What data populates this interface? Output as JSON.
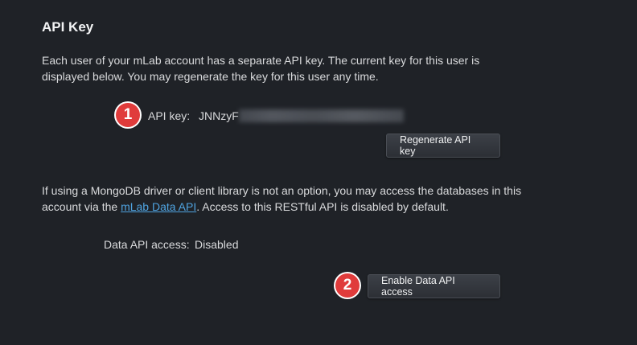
{
  "section": {
    "title": "API Key",
    "description": "Each user of your mLab account has a separate API key. The current key for this user is displayed below. You may regenerate the key for this user any time."
  },
  "api_key": {
    "label": "API key:",
    "value_visible": "JNNzyF",
    "value_obscured": true
  },
  "buttons": {
    "regenerate_label": "Regenerate API key",
    "enable_label": "Enable Data API access"
  },
  "data_api": {
    "text_before": "If using a MongoDB driver or client library is not an option, you may access the databases in this account via the ",
    "link_text": "mLab Data API",
    "text_after": ". Access to this RESTful API is disabled by default.",
    "access_label": "Data API access:",
    "access_value": "Disabled"
  },
  "markers": {
    "step1": "1",
    "step2": "2"
  },
  "colors": {
    "background": "#1f2227",
    "link": "#4fa3e0",
    "marker": "#e03b3b"
  }
}
